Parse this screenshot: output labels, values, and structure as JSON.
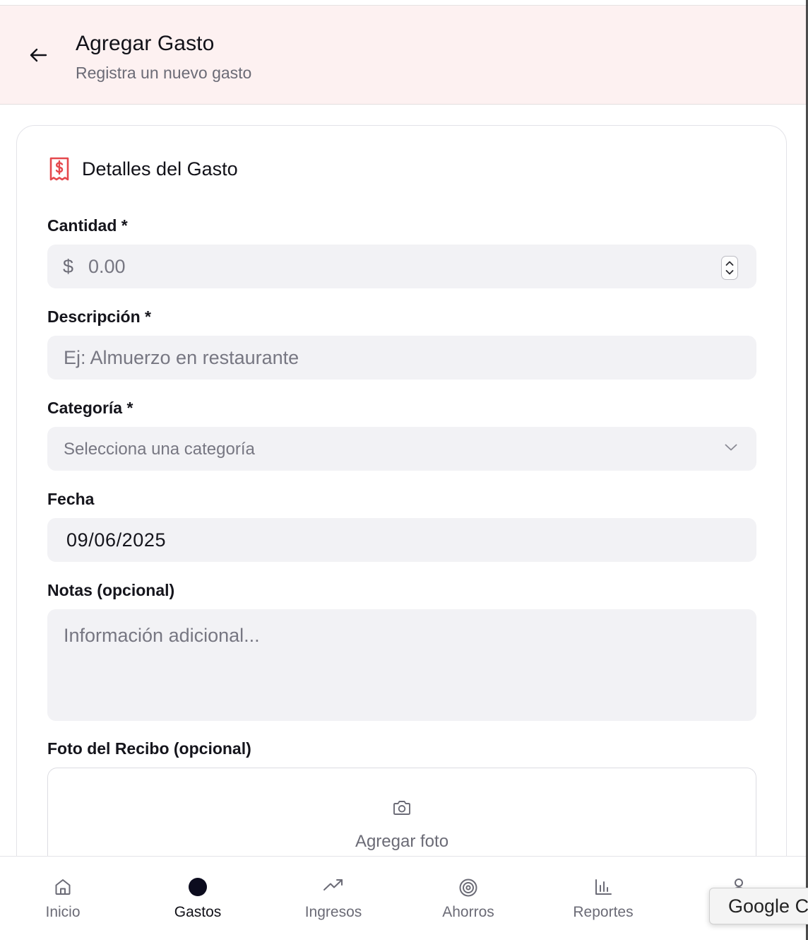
{
  "header": {
    "title": "Agregar Gasto",
    "subtitle": "Registra un nuevo gasto",
    "back_icon": "arrow-left-icon"
  },
  "card": {
    "title": "Detalles del Gasto",
    "icon": "receipt-dollar-icon"
  },
  "form": {
    "amount": {
      "label": "Cantidad *",
      "currency_symbol": "$",
      "placeholder": "0.00"
    },
    "description": {
      "label": "Descripción *",
      "placeholder": "Ej: Almuerzo en restaurante"
    },
    "category": {
      "label": "Categoría *",
      "placeholder": "Selecciona una categoría"
    },
    "date": {
      "label": "Fecha",
      "value": "09/06/2025"
    },
    "notes": {
      "label": "Notas (opcional)",
      "placeholder": "Información adicional..."
    },
    "receipt": {
      "label": "Foto del Recibo (opcional)",
      "button_label": "Agregar foto"
    }
  },
  "nav": {
    "items": [
      {
        "label": "Inicio",
        "icon": "home-icon",
        "active": false
      },
      {
        "label": "Gastos",
        "icon": "dot-icon",
        "active": true
      },
      {
        "label": "Ingresos",
        "icon": "trending-up-icon",
        "active": false
      },
      {
        "label": "Ahorros",
        "icon": "target-icon",
        "active": false
      },
      {
        "label": "Reportes",
        "icon": "bar-chart-icon",
        "active": false
      },
      {
        "label": "",
        "icon": "user-icon",
        "active": false
      }
    ]
  },
  "tooltip": {
    "text": "Google C"
  },
  "colors": {
    "header_bg": "#fdf1f1",
    "field_bg": "#f2f2f5",
    "accent_red": "#e5484d",
    "active_dot": "#0c0c1e"
  }
}
